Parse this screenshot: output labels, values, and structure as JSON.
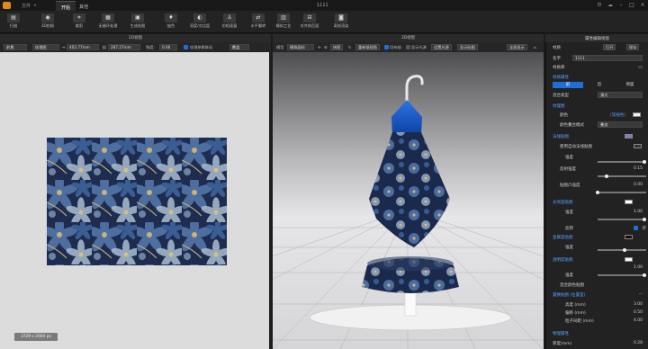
{
  "titlebar": {
    "menu_file": "文件",
    "tab_start": "开始",
    "tab_other": "其他",
    "window_title": "1111"
  },
  "toolbar": [
    {
      "label": "扫描",
      "icon": "scan-icon"
    },
    {
      "label": "3D拍照",
      "icon": "camera-icon"
    },
    {
      "label": "裁剪",
      "icon": "crop-icon"
    },
    {
      "label": "无缝环处理",
      "icon": "seamless-icon"
    },
    {
      "label": "生成贴图",
      "icon": "texture-icon"
    },
    {
      "label": "抽色",
      "icon": "color-pick-icon"
    },
    {
      "label": "亮度/对比度",
      "icon": "contrast-icon"
    },
    {
      "label": "仿相面窗",
      "icon": "person-icon"
    },
    {
      "label": "水平翻转",
      "icon": "flip-icon"
    },
    {
      "label": "模拟工艺",
      "icon": "craft-icon"
    },
    {
      "label": "对齐前后面",
      "icon": "align-icon"
    },
    {
      "label": "离线渲染",
      "icon": "render-icon"
    }
  ],
  "left_panel": {
    "title": "2D视窗",
    "unit": "前景",
    "mode": "纹理图",
    "width": "402.77mm",
    "height": "287.27mm",
    "angle_label": "角度:",
    "angle": "0.00",
    "sync_label": "纹理参数联动",
    "view_mode": "覆盖",
    "image_size": "3729 x 2660 px"
  },
  "center_panel": {
    "title": "3D视窗",
    "model_label": "模型",
    "model_value": "模拟面料",
    "btn_snapshot": "快照",
    "btn_reset": "重新镜视角",
    "chk_cut": "切布轴",
    "chk_light": "显示光源",
    "btn_light": "设置光源",
    "btn_tex": "显示贴图",
    "btn_full": "全屏显示"
  },
  "right_panel": {
    "title": "属性编辑视窗",
    "material_label": "材质",
    "btn_open": "打开",
    "btn_save": "保存",
    "name_label": "名字",
    "name_value": "1111",
    "library_label": "材质库",
    "texture_section": "材质属性",
    "tabs": [
      "前",
      "后",
      "侧面"
    ],
    "blend_label": "混合类型",
    "blend_value": "漫光",
    "diffuse_section": "纹理图",
    "color_label": "颜色",
    "color_value": "(常规色)",
    "color_mode_label": "颜色叠合模式",
    "color_mode_value": "叠加",
    "normal_section": "法线贴图",
    "normal_auto": "使用自动法线贴图",
    "strength_label": "强度",
    "strength_value": "1.00",
    "reflect_label": "反射强度",
    "reflect_value": "0.15",
    "bump_label": "贴图凸强度",
    "bump_value": "0.00",
    "gloss_section": "光亮度贴图",
    "gloss_strength_label": "强度",
    "gloss_strength_value": "1.00",
    "invert_label": "反转",
    "invert_value": "开",
    "metal_section": "金属度贴图",
    "metal_strength_label": "强度",
    "metal_strength_value": "1.00",
    "trans_section": "透明度贴图",
    "trans_strength_label": "强度",
    "trans_strength_value": "1.00",
    "alpha_label": "混合颜色贴图",
    "displace_section": "置换贴图 (位置型)",
    "height_label": "高度 (mm)",
    "height_value": "3.00",
    "offset_label": "偏移 (mm)",
    "offset_value": "0.50",
    "sub_label": "粒子间距 (mm)",
    "sub_value": "4.00",
    "physical_section": "物理属性",
    "thickness_label": "厚度(mm)",
    "thickness_value": "0.28"
  }
}
